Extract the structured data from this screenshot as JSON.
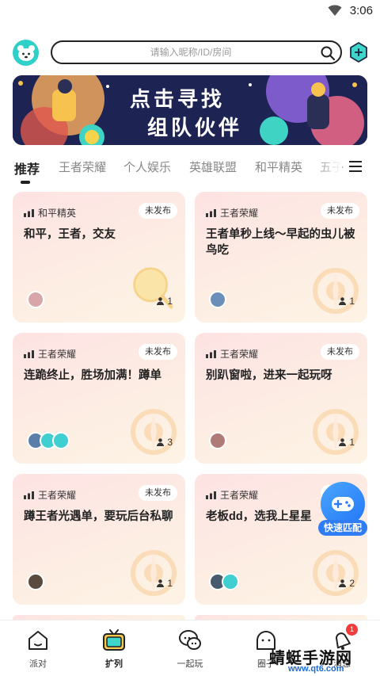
{
  "status_bar": {
    "time": "3:06"
  },
  "search": {
    "placeholder": "请输入昵称/ID/房间"
  },
  "banner": {
    "line1": "点击寻找",
    "line2": "组队伙伴"
  },
  "tabs": [
    {
      "label": "推荐"
    },
    {
      "label": "王者荣耀"
    },
    {
      "label": "个人娱乐"
    },
    {
      "label": "英雄联盟"
    },
    {
      "label": "和平精英"
    },
    {
      "label": "五子"
    }
  ],
  "cards": [
    {
      "tag": "和平精英",
      "status": "未发布",
      "title": "和平，王者，交友",
      "count": "1"
    },
    {
      "tag": "王者荣耀",
      "status": "未发布",
      "title": "王者单秒上线～早起的虫儿被鸟吃",
      "count": "1"
    },
    {
      "tag": "王者荣耀",
      "status": "未发布",
      "title": "连跪终止，胜场加满！蹲单",
      "count": "3"
    },
    {
      "tag": "王者荣耀",
      "status": "未发布",
      "title": "别趴窗啦，进来一起玩呀",
      "count": "1"
    },
    {
      "tag": "王者荣耀",
      "status": "未发布",
      "title": "蹲王者光遇单，要玩后台私聊",
      "count": "1"
    },
    {
      "tag": "王者荣耀",
      "status": "未发布",
      "title": "老板dd，选我上星星",
      "count": "2"
    }
  ],
  "fab": {
    "label": "快速匹配"
  },
  "bottom_nav": [
    {
      "label": "派对"
    },
    {
      "label": "扩列"
    },
    {
      "label": "一起玩"
    },
    {
      "label": "圈子"
    },
    {
      "label": "消息"
    }
  ],
  "message_badge": "1",
  "watermark": {
    "line1": "蜻蜓手游网",
    "line2": "www.qt6.com"
  },
  "colors": {
    "accent_teal": "#2ed0c8",
    "fab_blue": "#2f7cf4",
    "card_bg": "#fde8e3",
    "badge_red": "#f23c3c"
  }
}
